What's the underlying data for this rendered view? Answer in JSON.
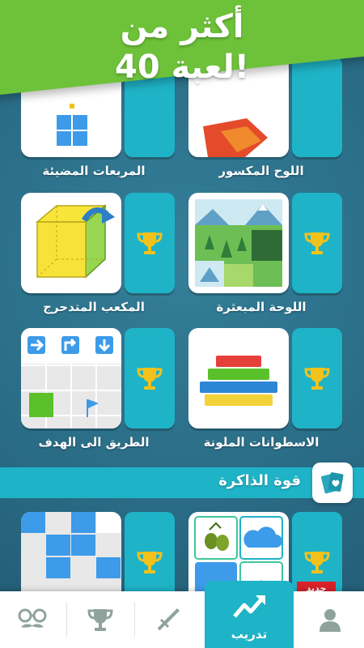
{
  "banner": {
    "line1": "أكثر من",
    "line2": "40 لعبة!"
  },
  "games": [
    {
      "name": "المربعات المضيئة"
    },
    {
      "name": "اللوح المكسور"
    },
    {
      "name": "المكعب المتدحرج"
    },
    {
      "name": "اللوحة المبعثرة"
    },
    {
      "name": "الطريق الى الهدف"
    },
    {
      "name": "الاسطوانات الملونة"
    }
  ],
  "section": {
    "title": "قوة الذاكرة"
  },
  "new_badge": "جديد",
  "nav": {
    "active_label": "تدريب"
  },
  "colors": {
    "accent": "#1fb3c7",
    "banner": "#6ec23a",
    "trophy": "#f2c21b",
    "background": "#2a6f8a"
  }
}
